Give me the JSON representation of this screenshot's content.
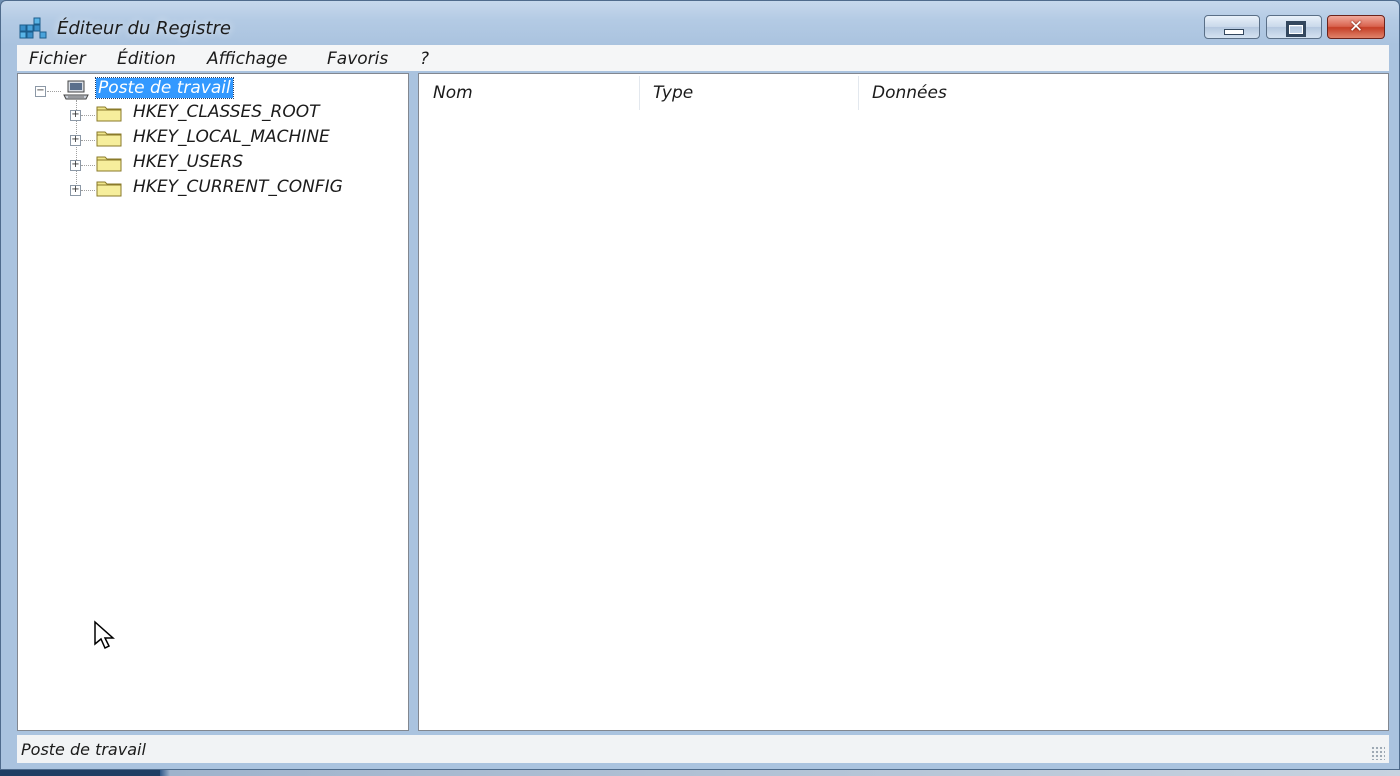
{
  "window": {
    "title": "Éditeur du Registre",
    "close_glyph": "✕"
  },
  "menu": [
    "Fichier",
    "Édition",
    "Affichage",
    "Favoris",
    "?"
  ],
  "tree": {
    "root": "Poste de travail",
    "children": [
      "HKEY_CLASSES_ROOT",
      "HKEY_LOCAL_MACHINE",
      "HKEY_USERS",
      "HKEY_CURRENT_CONFIG"
    ]
  },
  "list": {
    "columns": [
      "Nom",
      "Type",
      "Données"
    ]
  },
  "status": {
    "text": "Poste de travail"
  },
  "colors": {
    "selection": "#3399ff",
    "folder": "#f0e68c"
  },
  "icons": {
    "app": "registry-icon",
    "root": "computer-icon",
    "node": "folder-icon"
  }
}
